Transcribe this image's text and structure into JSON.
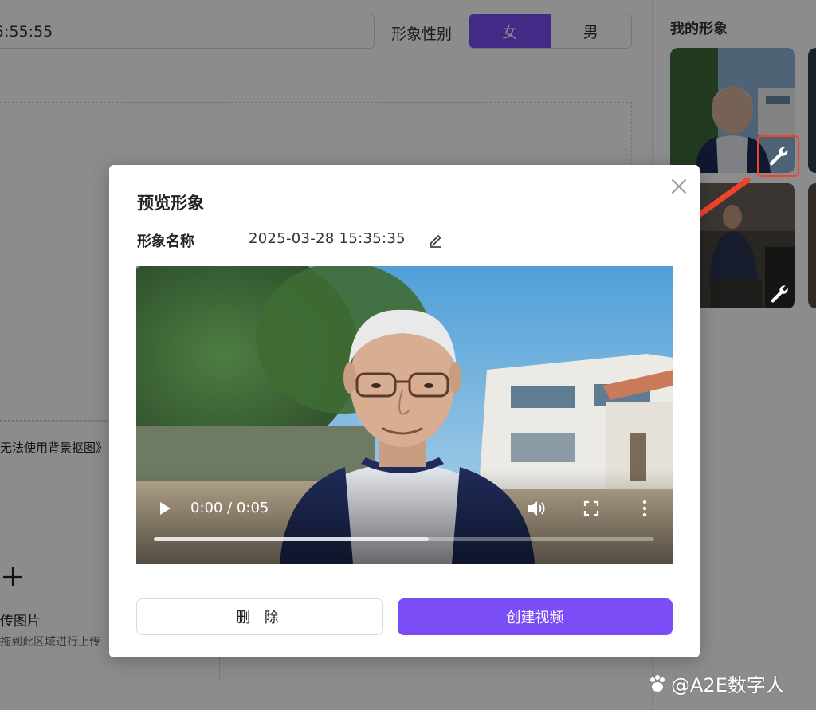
{
  "form": {
    "name_value": "5:55:55",
    "gender_label": "形象性别",
    "gender_options": [
      "女",
      "男"
    ],
    "gender_selected": "女",
    "bg_warning": "无法使用背景抠图》",
    "upload_title": "传图片",
    "upload_hint": "拖到此区域进行上传"
  },
  "sidebar": {
    "title": "我的形象"
  },
  "modal": {
    "title": "预览形象",
    "field_label": "形象名称",
    "field_value": "2025-03-28 15:35:35",
    "video": {
      "time": "0:00 / 0:05",
      "progress_fraction": 0,
      "buffered_fraction": 0.55
    },
    "delete_label": "删 除",
    "create_label": "创建视频"
  },
  "watermark": {
    "text": "@A2E数字人"
  },
  "colors": {
    "accent": "#7a4df6",
    "highlight": "#f0432b"
  },
  "icons": [
    "close-icon",
    "edit-icon",
    "play-icon",
    "volume-icon",
    "fullscreen-icon",
    "more-vertical-icon",
    "wrench-icon",
    "plus-icon",
    "paw-icon"
  ]
}
